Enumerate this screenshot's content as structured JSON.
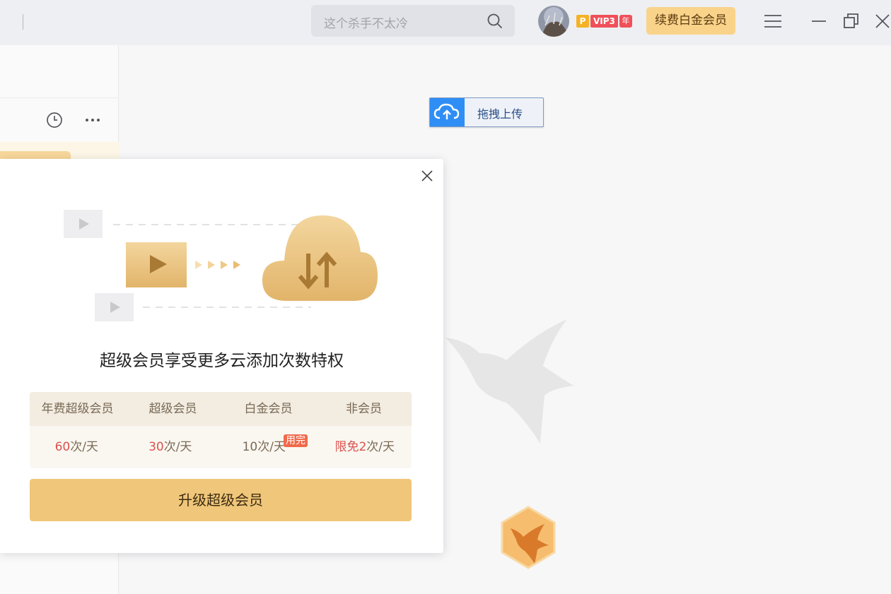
{
  "search": {
    "placeholder": "这个杀手不太冷"
  },
  "account": {
    "badge_p": "P",
    "badge_vip": "VIP3",
    "badge_year": "年",
    "renew_label": "续费白金会员"
  },
  "upload": {
    "label": "拖拽上传"
  },
  "modal": {
    "title": "超级会员享受更多云添加次数特权",
    "table": {
      "headers": [
        "年费超级会员",
        "超级会员",
        "白金会员",
        "非会员"
      ],
      "rows": [
        {
          "num": "60",
          "unit": "次/天"
        },
        {
          "num": "30",
          "unit": "次/天"
        },
        {
          "num": "10",
          "unit": "次/天",
          "tag": "用完"
        },
        {
          "prefix": "限免",
          "num": "2",
          "unit": "次/天"
        }
      ]
    },
    "upgrade_label": "升级超级会员"
  },
  "colors": {
    "accent_gold": "#f0c67a",
    "upload_blue": "#2f8ef5",
    "vip_red": "#f0505a"
  }
}
